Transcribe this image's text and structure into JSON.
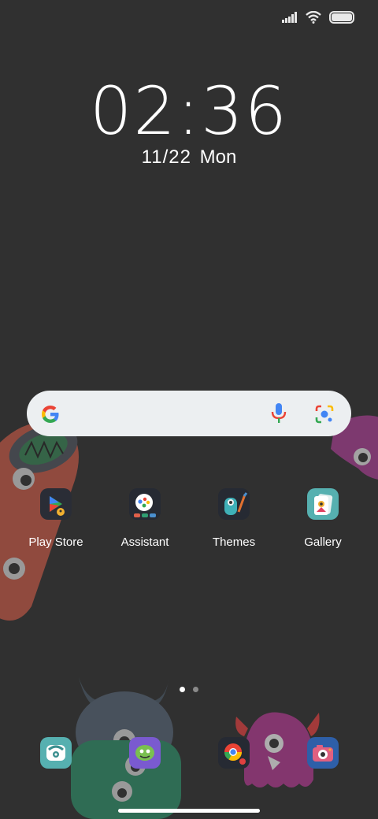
{
  "status_bar": {
    "icons": [
      "signal-icon",
      "wifi-icon",
      "battery-icon"
    ],
    "battery_level": 1.0
  },
  "clock": {
    "time": "02:36",
    "date": "11/22",
    "day": "Mon"
  },
  "search": {
    "icons": [
      "google-logo-icon",
      "microphone-icon",
      "google-lens-icon"
    ]
  },
  "apps": [
    {
      "label": "Play Store",
      "icon": "play-store-icon"
    },
    {
      "label": "Assistant",
      "icon": "assistant-icon"
    },
    {
      "label": "Themes",
      "icon": "themes-icon"
    },
    {
      "label": "Gallery",
      "icon": "gallery-icon"
    }
  ],
  "dock": [
    {
      "icon": "phone-icon"
    },
    {
      "icon": "messages-icon"
    },
    {
      "icon": "chrome-icon"
    },
    {
      "icon": "camera-icon"
    }
  ],
  "pages": {
    "count": 2,
    "active": 1
  },
  "colors": {
    "background": "#303030",
    "text": "#ffffff",
    "search_bar": "#eceff1"
  }
}
